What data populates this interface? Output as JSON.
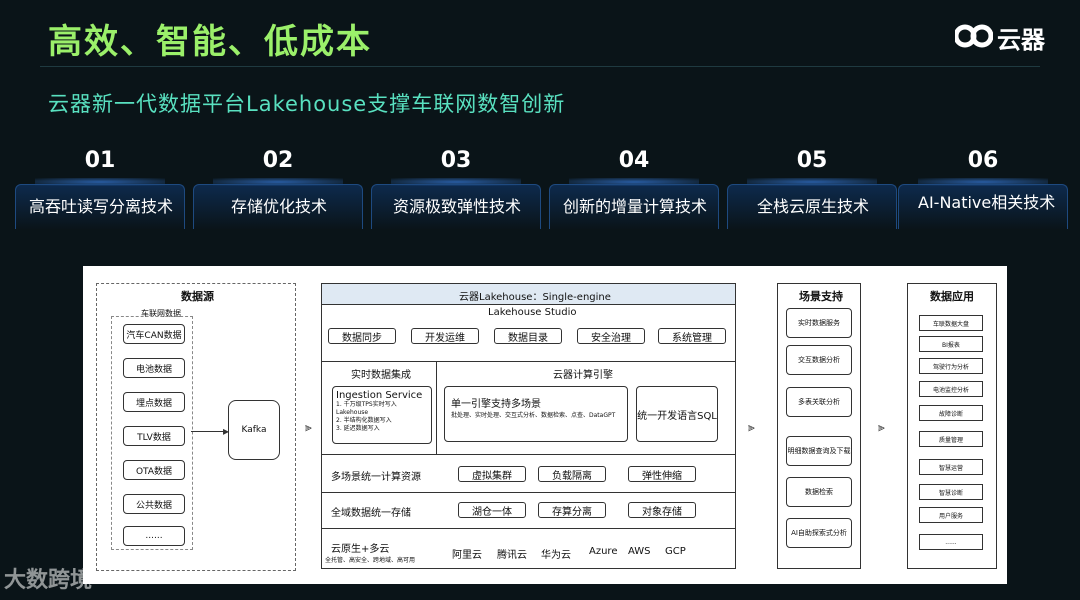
{
  "header": {
    "title": "高效、智能、低成本",
    "logo_name": "云器",
    "subtitle": "云器新一代数据平台Lakehouse支撑车联网数智创新"
  },
  "techs": [
    {
      "num": "01",
      "label": "高吞吐读写分离技术"
    },
    {
      "num": "02",
      "label": "存储优化技术"
    },
    {
      "num": "03",
      "label": "资源极致弹性技术"
    },
    {
      "num": "04",
      "label": "创新的增量计算技术"
    },
    {
      "num": "05",
      "label": "全栈云原生技术"
    },
    {
      "num": "06",
      "label": "AI-Native相关技术"
    }
  ],
  "diagram": {
    "sources_title": "数据源",
    "sources_group": "车联网数据",
    "sources": [
      "汽车CAN数据",
      "电池数据",
      "埋点数据",
      "TLV数据",
      "OTA数据",
      "公共数据",
      "......"
    ],
    "kafka": "Kafka",
    "lakehouse_title": "云器Lakehouse：Single-engine",
    "studio": "Lakehouse Studio",
    "studio_buttons": [
      "数据同步",
      "开发运维",
      "数据目录",
      "安全治理",
      "系统管理"
    ],
    "realtime_title": "实时数据集成",
    "ingestion_title": "Ingestion Service",
    "ingestion_items": [
      "1. 千万级TPS实时写入Lakehouse",
      "2. 半结构化数据写入",
      "3. 延迟数据写入"
    ],
    "engine_title": "云器计算引擎",
    "engine_single": "单一引擎支持多场景",
    "engine_single_desc": "批处理、实时处理、交互式分析、数据检索、点查、DataGPT",
    "engine_sql": "统一开发语言SQL",
    "compute_label": "多场景统一计算资源",
    "compute_items": [
      "虚拟集群",
      "负载隔离",
      "弹性伸缩"
    ],
    "storage_label": "全域数据统一存储",
    "storage_items": [
      "湖仓一体",
      "存算分离",
      "对象存储"
    ],
    "cloud_label": "云原生+多云",
    "cloud_desc": "全托管、高安全、跨地域、高可用",
    "clouds": [
      "阿里云",
      "腾讯云",
      "华为云",
      "Azure",
      "AWS",
      "GCP"
    ],
    "scenes_title": "场景支持",
    "scenes": [
      "实时数据服务",
      "交互数据分析",
      "多表关联分析",
      "明细数据查询及下载",
      "数据检索",
      "AI自助探索式分析"
    ],
    "apps_title": "数据应用",
    "apps": [
      "车联数据大盘",
      "BI报表",
      "驾驶行为分析",
      "电池监控分析",
      "故障诊断",
      "质量管理",
      "智慧运营",
      "智慧诊断",
      "用户服务",
      "......"
    ]
  },
  "watermark": "大数跨境"
}
